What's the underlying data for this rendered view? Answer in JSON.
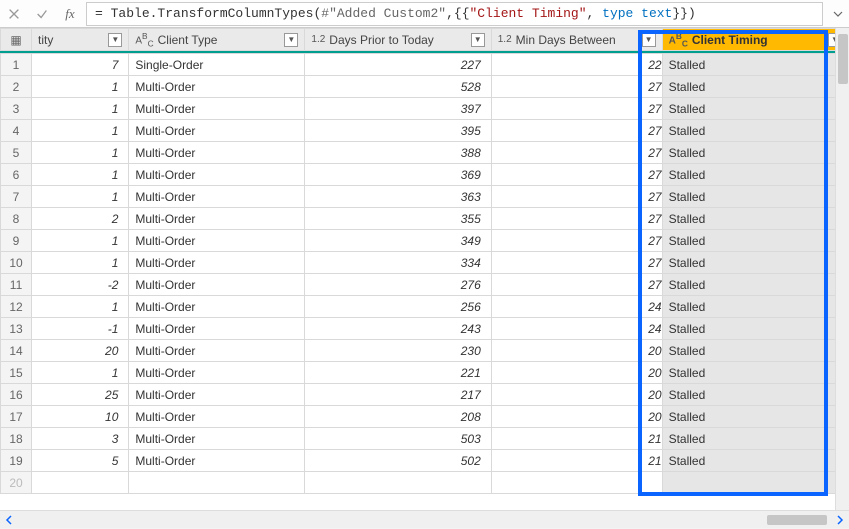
{
  "formula": {
    "prefix": "= ",
    "fn1": "Table.TransformColumnTypes",
    "open": "(",
    "hash": "#\"Added Custom2\"",
    "mid": ",{{",
    "str": "\"Client Timing\"",
    "mid2": ", ",
    "kw": "type text",
    "close": "}})"
  },
  "columns": {
    "rowhdr_icon": "▦",
    "qty_label": "tity",
    "qty_type": "",
    "clienttype_label": "Client Type",
    "clienttype_type": "ABC",
    "days_label": "Days Prior to Today",
    "days_type": "1.2",
    "mindays_label": "Min Days Between",
    "mindays_type": "1.2",
    "timing_label": "Client Timing",
    "timing_type": "ABC"
  },
  "rows": [
    {
      "n": "1",
      "qty": "7",
      "ctype": "Single-Order",
      "days": "227",
      "min": "22",
      "timing": "Stalled"
    },
    {
      "n": "2",
      "qty": "1",
      "ctype": "Multi-Order",
      "days": "528",
      "min": "27",
      "timing": "Stalled"
    },
    {
      "n": "3",
      "qty": "1",
      "ctype": "Multi-Order",
      "days": "397",
      "min": "27",
      "timing": "Stalled"
    },
    {
      "n": "4",
      "qty": "1",
      "ctype": "Multi-Order",
      "days": "395",
      "min": "27",
      "timing": "Stalled"
    },
    {
      "n": "5",
      "qty": "1",
      "ctype": "Multi-Order",
      "days": "388",
      "min": "27",
      "timing": "Stalled"
    },
    {
      "n": "6",
      "qty": "1",
      "ctype": "Multi-Order",
      "days": "369",
      "min": "27",
      "timing": "Stalled"
    },
    {
      "n": "7",
      "qty": "1",
      "ctype": "Multi-Order",
      "days": "363",
      "min": "27",
      "timing": "Stalled"
    },
    {
      "n": "8",
      "qty": "2",
      "ctype": "Multi-Order",
      "days": "355",
      "min": "27",
      "timing": "Stalled"
    },
    {
      "n": "9",
      "qty": "1",
      "ctype": "Multi-Order",
      "days": "349",
      "min": "27",
      "timing": "Stalled"
    },
    {
      "n": "10",
      "qty": "1",
      "ctype": "Multi-Order",
      "days": "334",
      "min": "27",
      "timing": "Stalled"
    },
    {
      "n": "11",
      "qty": "-2",
      "ctype": "Multi-Order",
      "days": "276",
      "min": "27",
      "timing": "Stalled"
    },
    {
      "n": "12",
      "qty": "1",
      "ctype": "Multi-Order",
      "days": "256",
      "min": "24",
      "timing": "Stalled"
    },
    {
      "n": "13",
      "qty": "-1",
      "ctype": "Multi-Order",
      "days": "243",
      "min": "24",
      "timing": "Stalled"
    },
    {
      "n": "14",
      "qty": "20",
      "ctype": "Multi-Order",
      "days": "230",
      "min": "20",
      "timing": "Stalled"
    },
    {
      "n": "15",
      "qty": "1",
      "ctype": "Multi-Order",
      "days": "221",
      "min": "20",
      "timing": "Stalled"
    },
    {
      "n": "16",
      "qty": "25",
      "ctype": "Multi-Order",
      "days": "217",
      "min": "20",
      "timing": "Stalled"
    },
    {
      "n": "17",
      "qty": "10",
      "ctype": "Multi-Order",
      "days": "208",
      "min": "20",
      "timing": "Stalled"
    },
    {
      "n": "18",
      "qty": "3",
      "ctype": "Multi-Order",
      "days": "503",
      "min": "21",
      "timing": "Stalled"
    },
    {
      "n": "19",
      "qty": "5",
      "ctype": "Multi-Order",
      "days": "502",
      "min": "21",
      "timing": "Stalled"
    }
  ],
  "emptyRow": "20"
}
